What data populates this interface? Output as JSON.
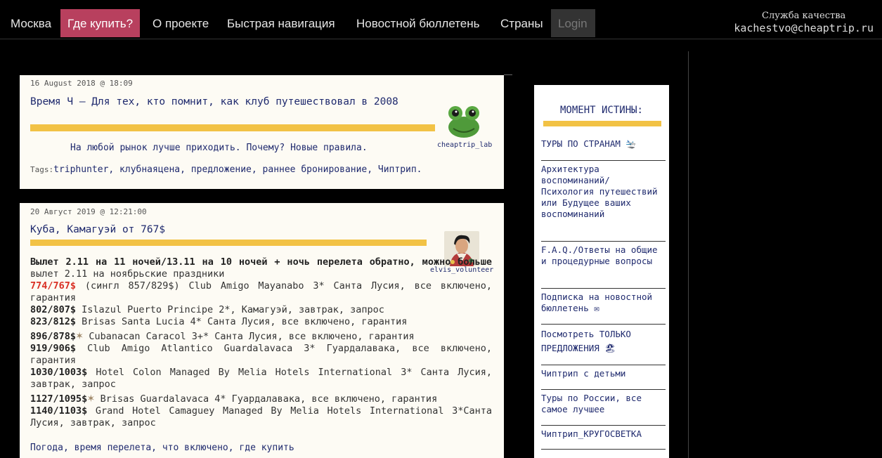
{
  "nav": {
    "items": [
      "Москва",
      "Где купить?",
      "О проекте",
      "Быстрая навигация",
      "Новостной бюллетень",
      "Страны",
      "Login"
    ]
  },
  "quality": {
    "title": "Служба качества",
    "email": "kachestvo@cheaptrip.ru"
  },
  "post1": {
    "date": "16 August 2018 @ 18:09",
    "title": "Время Ч – Для тех, кто помнит, как клуб путешествовал в 2008",
    "author": "cheaptrip_lab",
    "body": "На любой рынок лучше приходить. Почему? Новые правила.",
    "tags_label": "Tags:",
    "tags": "triphunter, клубнаяцена, предложение, раннее бронирование, Чиптрип."
  },
  "post2": {
    "date": "20 Август 2019 @ 12:21:00",
    "title": "Куба, Камагуэй от 767$",
    "author": "elvis_volunteer",
    "intro_bold": "Вылет 2.11 на 11 ночей/13.11 на 10 ночей + ночь перелета обратно, можно больше",
    "intro_rest": " вылет 2.11 на ноябрьские праздники",
    "lines": [
      {
        "price": "774/767$",
        "text": " (сингл 857/829$) Club Amigo Mayanabo 3* Санта Лусия, все включено, гарантия"
      },
      {
        "price": "802/807$",
        "text": " Islazul Puerto Principe 2*, Камагуэй, завтрак, запрос"
      },
      {
        "price": "823/812$",
        "text": " Brisas Santa Lucia 4* Санта Лусия, все включено, гарантия"
      },
      {
        "price": "896/878$",
        "text": " Cubanacan Caracol 3+* Санта Лусия, все включено, гарантия"
      },
      {
        "price": "919/906$",
        "text": " Club Amigo Atlantico Guardalavaca 3* Гуардалавака, все включено, гарантия"
      },
      {
        "price": "1030/1003$",
        "text": " Hotel Colon Managed By Melia Hotels International 3* Санта Лусия, завтрак, запрос"
      },
      {
        "price": "1127/1095$",
        "text": " Brisas Guardalavaca 4* Гуардалавака, все включено, гарантия"
      },
      {
        "price": "1140/1103$",
        "text": " Grand Hotel Camaguey Managed By Melia Hotels International 3*Санта Лусия, завтрак, запрос"
      }
    ],
    "footer": "Погода, время перелета, что включено, где купить"
  },
  "sidebar": {
    "title": "МОМЕНТ ИСТИНЫ:",
    "items": [
      "ТУРЫ ПО СТРАНАМ 🛬",
      "Архитектура воспоминаний/ Психология путешествий или Будущее ваших воспоминаний",
      "F.A.Q./Ответы на общие и процедурные вопросы",
      "Подписка на новостной бюллетень ✉",
      "Посмотреть ТОЛЬКО ПРЕДЛОЖЕНИЯ 🏖",
      "Чиптрип с детьми",
      "Туры по России, все самое лучшее",
      "Чиптрип_КРУГОСВЕТКА"
    ]
  },
  "colors": {
    "accent": "#b8405e",
    "bar": "#f2c245",
    "link": "#1f2a6e",
    "price_red": "#d93025"
  }
}
